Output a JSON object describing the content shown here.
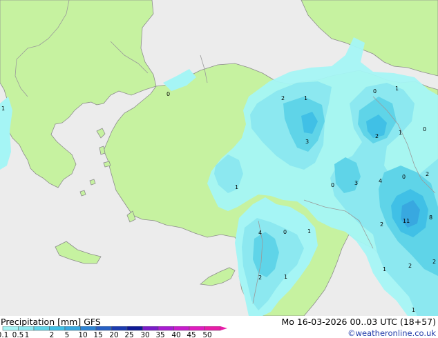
{
  "product": "Precipitation [mm]",
  "model": "GFS",
  "valid_time": "Mo 16-03-2026 00..03 UTC (18+57)",
  "credit": "©weatheronline.co.uk",
  "scale": {
    "labels": [
      "0.1",
      "0.5",
      "1",
      "2",
      "5",
      "10",
      "15",
      "20",
      "25",
      "30",
      "35",
      "40",
      "45",
      "50"
    ],
    "colors": [
      "#a5f5f5",
      "#8ce8f0",
      "#5fd4e8",
      "#40c0e6",
      "#38a8e0",
      "#2e84d4",
      "#2660c4",
      "#1c3cb0",
      "#0f1a96",
      "#7a1cc8",
      "#a81cd2",
      "#c81ccc",
      "#e01cc0",
      "#e81ca8"
    ]
  },
  "map_labels": [
    {
      "text": "0",
      "area": "sea of marmara"
    },
    {
      "text": "2",
      "area": "north-central anatolia"
    },
    {
      "text": "1",
      "area": "north-central anatolia"
    },
    {
      "text": "0",
      "area": "northeast"
    },
    {
      "text": "1",
      "area": "northeast"
    },
    {
      "text": "1",
      "area": "west balkans edge"
    },
    {
      "text": "3",
      "area": "central anatolia"
    },
    {
      "text": "2",
      "area": "caucasus"
    },
    {
      "text": "1",
      "area": "caucasus"
    },
    {
      "text": "0",
      "area": "caucasus"
    },
    {
      "text": "0",
      "area": "eastern anatolia"
    },
    {
      "text": "3",
      "area": "eastern anatolia"
    },
    {
      "text": "4",
      "area": "eastern anatolia"
    },
    {
      "text": "0",
      "area": "iran"
    },
    {
      "text": "2",
      "area": "caspian"
    },
    {
      "text": "1",
      "area": "west anatolia"
    },
    {
      "text": "4",
      "area": "levant coast"
    },
    {
      "text": "0",
      "area": "syria"
    },
    {
      "text": "1",
      "area": "syria"
    },
    {
      "text": "2",
      "area": "iraq"
    },
    {
      "text": "11",
      "area": "iran maximum"
    },
    {
      "text": "8",
      "area": "iran east"
    },
    {
      "text": "2",
      "area": "lebanon"
    },
    {
      "text": "1",
      "area": "syria south"
    },
    {
      "text": "1",
      "area": "iraq south"
    },
    {
      "text": "2",
      "area": "iran south"
    },
    {
      "text": "2",
      "area": "iran edge"
    },
    {
      "text": "1",
      "area": "iran south edge"
    }
  ],
  "colors": {
    "land": "#c6f2a0",
    "sea": "#ececec",
    "border": "#8c8c8c"
  }
}
